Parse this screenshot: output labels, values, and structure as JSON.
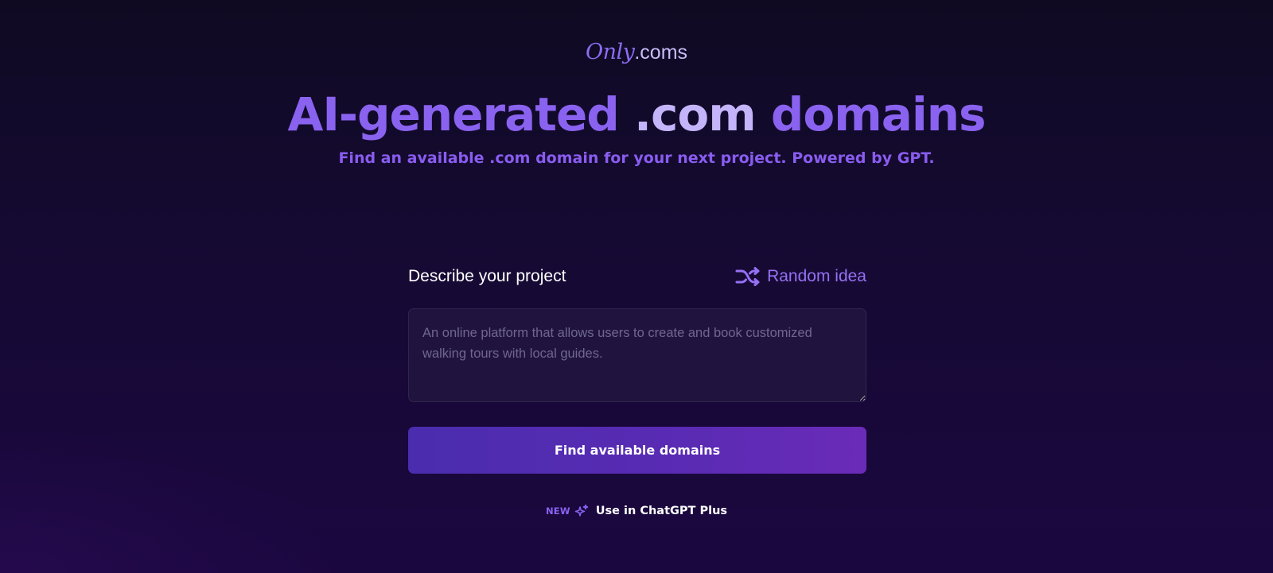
{
  "logo": {
    "script": "Only",
    "suffix": ".coms"
  },
  "hero": {
    "title_part1": "AI-generated ",
    "title_part2": ".com",
    "title_part3": " domains",
    "subtitle": "Find an available .com domain for your next project. Powered by GPT."
  },
  "form": {
    "label": "Describe your project",
    "random_label": "Random idea",
    "random_icon": "shuffle-icon",
    "textarea_value": "",
    "textarea_placeholder": "An online platform that allows users to create and book customized walking tours with local guides.",
    "submit_label": "Find available domains"
  },
  "promo": {
    "badge": "NEW",
    "icon": "sparkle-icon",
    "link_label": "Use in ChatGPT Plus"
  },
  "colors": {
    "accent": "#8a62f0",
    "accent_light": "#c4b4fa",
    "button": "#5a2bb4",
    "background": "#150a32"
  }
}
